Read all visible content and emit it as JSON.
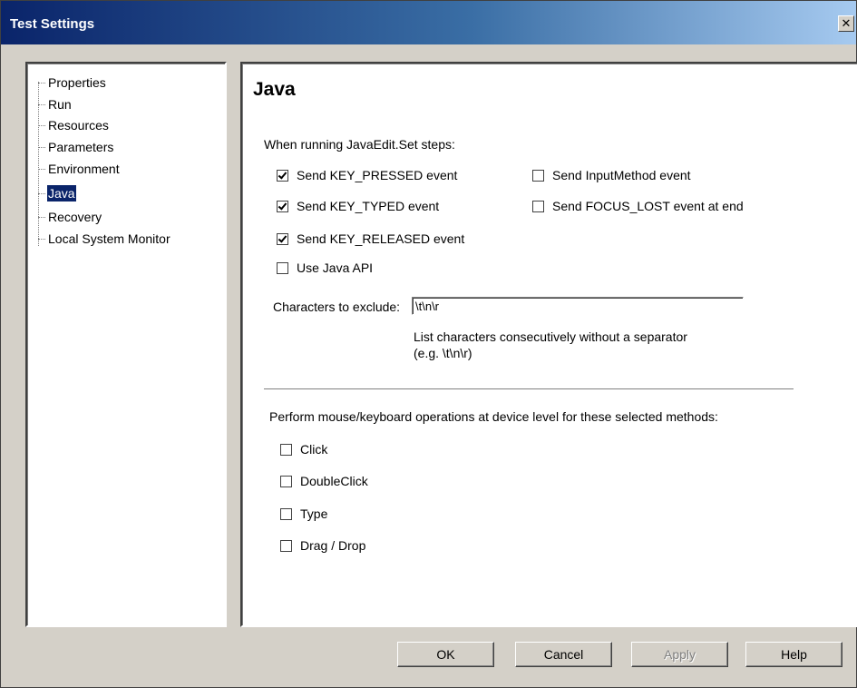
{
  "window": {
    "title": "Test Settings",
    "close_glyph": "✕"
  },
  "tree": {
    "items": [
      {
        "label": "Properties"
      },
      {
        "label": "Run"
      },
      {
        "label": "Resources"
      },
      {
        "label": "Parameters"
      },
      {
        "label": "Environment"
      },
      {
        "label": "Java",
        "selected": true
      },
      {
        "label": "Recovery"
      },
      {
        "label": "Local System Monitor"
      }
    ]
  },
  "java": {
    "heading": "Java",
    "set_steps_label": "When running JavaEdit.Set steps:",
    "options": {
      "key_pressed": {
        "label": "Send KEY_PRESSED event",
        "checked": true
      },
      "key_typed": {
        "label": "Send KEY_TYPED event",
        "checked": true
      },
      "key_released": {
        "label": "Send KEY_RELEASED event",
        "checked": true
      },
      "use_java_api": {
        "label": "Use Java API",
        "checked": false
      },
      "input_method": {
        "label": "Send InputMethod event",
        "checked": false
      },
      "focus_lost": {
        "label": "Send FOCUS_LOST event at end",
        "checked": false
      }
    },
    "exclude_label": "Characters to exclude:",
    "exclude_value": "\\t\\n\\r",
    "exclude_hint_1": "List characters consecutively without a separator",
    "exclude_hint_2": "(e.g. \\t\\n\\r)",
    "device_label": "Perform mouse/keyboard operations at device level for these selected methods:",
    "methods": {
      "click": {
        "label": "Click",
        "checked": false
      },
      "doubleclick": {
        "label": "DoubleClick",
        "checked": false
      },
      "type": {
        "label": "Type",
        "checked": false
      },
      "dragdrop": {
        "label": "Drag / Drop",
        "checked": false
      }
    }
  },
  "buttons": {
    "ok": "OK",
    "cancel": "Cancel",
    "apply": "Apply",
    "help": "Help"
  }
}
